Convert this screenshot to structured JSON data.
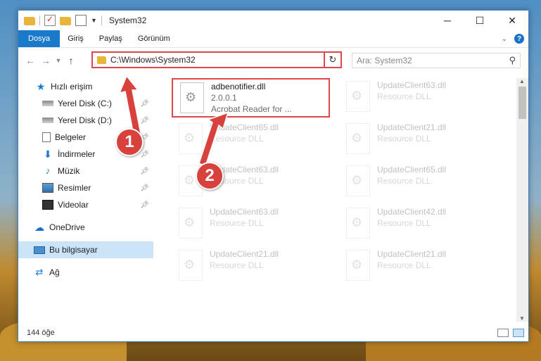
{
  "window": {
    "title": "System32",
    "controls": {
      "minimize": "─",
      "maximize": "☐",
      "close": "✕"
    }
  },
  "ribbon": {
    "tabs": [
      "Dosya",
      "Giriş",
      "Paylaş",
      "Görünüm"
    ],
    "help": "?"
  },
  "nav": {
    "address": "C:\\Windows\\System32",
    "search_placeholder": "Ara: System32"
  },
  "sidebar": {
    "quick_access": "Hızlı erişim",
    "items": [
      {
        "label": "Yerel Disk (C:)",
        "icon": "disk-icon"
      },
      {
        "label": "Yerel Disk (D:)",
        "icon": "disk-icon"
      },
      {
        "label": "Belgeler",
        "icon": "documents-icon"
      },
      {
        "label": "İndirmeler",
        "icon": "downloads-icon"
      },
      {
        "label": "Müzik",
        "icon": "music-icon"
      },
      {
        "label": "Resimler",
        "icon": "pictures-icon"
      },
      {
        "label": "Videolar",
        "icon": "videos-icon"
      }
    ],
    "onedrive": "OneDrive",
    "this_pc": "Bu bilgisayar",
    "network": "Ağ"
  },
  "files": [
    {
      "name": "adbenotifier.dll",
      "line2": "2.0.0.1",
      "line3": "Acrobat Reader for ...",
      "highlighted": true
    },
    {
      "name": "UpdateClient63.dll",
      "line2": "Resource DLL"
    },
    {
      "name": "UpdateClient65.dll",
      "line2": "Resource DLL"
    },
    {
      "name": "UpdateClient21.dll",
      "line2": "Resource DLL"
    },
    {
      "name": "UpdateClient63.dll",
      "line2": "Resource DLL"
    },
    {
      "name": "UpdateClient65.dll",
      "line2": "Resource DLL"
    },
    {
      "name": "UpdateClient63.dll",
      "line2": "Resource DLL"
    },
    {
      "name": "UpdateClient42.dll",
      "line2": "Resource DLL"
    },
    {
      "name": "UpdateClient21.dll",
      "line2": "Resource DLL"
    },
    {
      "name": "UpdateClient21.dll",
      "line2": "Resource DLL"
    }
  ],
  "status": {
    "count": "144 öğe"
  },
  "annotations": {
    "badge1": "1",
    "badge2": "2",
    "color": "#d9413d"
  }
}
